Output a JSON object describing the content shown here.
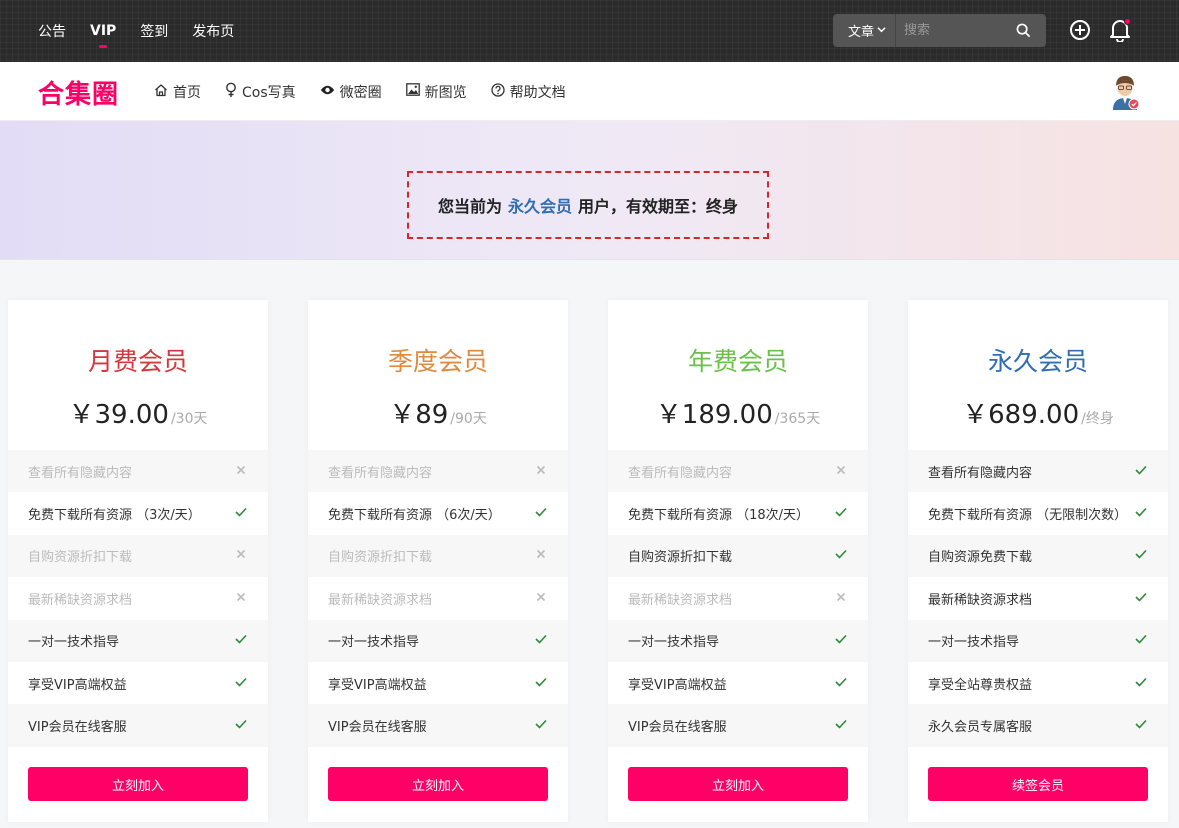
{
  "topbar": {
    "nav": [
      {
        "label": "公告",
        "active": false
      },
      {
        "label": "VIP",
        "active": true
      },
      {
        "label": "签到",
        "active": false
      },
      {
        "label": "发布页",
        "active": false
      }
    ],
    "search": {
      "type_label": "文章",
      "placeholder": "搜索"
    },
    "icons": [
      "chevron-down-icon",
      "search-icon",
      "plus-circle-icon",
      "bell-icon"
    ]
  },
  "mainnav": {
    "logo": "合集圈",
    "links": [
      {
        "label": "首页",
        "icon": "home-icon"
      },
      {
        "label": "Cos写真",
        "icon": "female-icon"
      },
      {
        "label": "微密圈",
        "icon": "eye-icon"
      },
      {
        "label": "新图览",
        "icon": "image-icon"
      },
      {
        "label": "帮助文档",
        "icon": "help-circle-icon"
      }
    ]
  },
  "banner": {
    "prefix": "您当前为",
    "level": "永久会员",
    "suffix": "用户，有效期至：终身"
  },
  "colors": {
    "accent": "#ff0066",
    "monthly": "#d6373a",
    "quarterly": "#e08a3c",
    "yearly": "#6cc04a",
    "lifetime": "#2f6db5",
    "check": "#2e8b3a"
  },
  "plans": [
    {
      "name": "月费会员",
      "color": "#d6373a",
      "price": "￥39.00",
      "period": "/30天",
      "button": "立刻加入",
      "features": [
        {
          "label": "查看所有隐藏内容",
          "included": false
        },
        {
          "label": "免费下载所有资源 （3次/天）",
          "included": true
        },
        {
          "label": "自购资源折扣下载",
          "included": false
        },
        {
          "label": "最新稀缺资源求档",
          "included": false
        },
        {
          "label": "一对一技术指导",
          "included": true
        },
        {
          "label": "享受VIP高端权益",
          "included": true
        },
        {
          "label": "VIP会员在线客服",
          "included": true
        }
      ]
    },
    {
      "name": "季度会员",
      "color": "#e08a3c",
      "price": "￥89",
      "period": "/90天",
      "button": "立刻加入",
      "features": [
        {
          "label": "查看所有隐藏内容",
          "included": false
        },
        {
          "label": "免费下载所有资源 （6次/天）",
          "included": true
        },
        {
          "label": "自购资源折扣下载",
          "included": false
        },
        {
          "label": "最新稀缺资源求档",
          "included": false
        },
        {
          "label": "一对一技术指导",
          "included": true
        },
        {
          "label": "享受VIP高端权益",
          "included": true
        },
        {
          "label": "VIP会员在线客服",
          "included": true
        }
      ]
    },
    {
      "name": "年费会员",
      "color": "#6cc04a",
      "price": "￥189.00",
      "period": "/365天",
      "button": "立刻加入",
      "features": [
        {
          "label": "查看所有隐藏内容",
          "included": false
        },
        {
          "label": "免费下载所有资源 （18次/天）",
          "included": true
        },
        {
          "label": "自购资源折扣下载",
          "included": true
        },
        {
          "label": "最新稀缺资源求档",
          "included": false
        },
        {
          "label": "一对一技术指导",
          "included": true
        },
        {
          "label": "享受VIP高端权益",
          "included": true
        },
        {
          "label": "VIP会员在线客服",
          "included": true
        }
      ]
    },
    {
      "name": "永久会员",
      "color": "#2f6db5",
      "price": "￥689.00",
      "period": "/终身",
      "button": "续签会员",
      "features": [
        {
          "label": "查看所有隐藏内容",
          "included": true
        },
        {
          "label": "免费下载所有资源 （无限制次数）",
          "included": true
        },
        {
          "label": "自购资源免费下载",
          "included": true
        },
        {
          "label": "最新稀缺资源求档",
          "included": true
        },
        {
          "label": "一对一技术指导",
          "included": true
        },
        {
          "label": "享受全站尊贵权益",
          "included": true
        },
        {
          "label": "永久会员专属客服",
          "included": true
        }
      ]
    }
  ]
}
